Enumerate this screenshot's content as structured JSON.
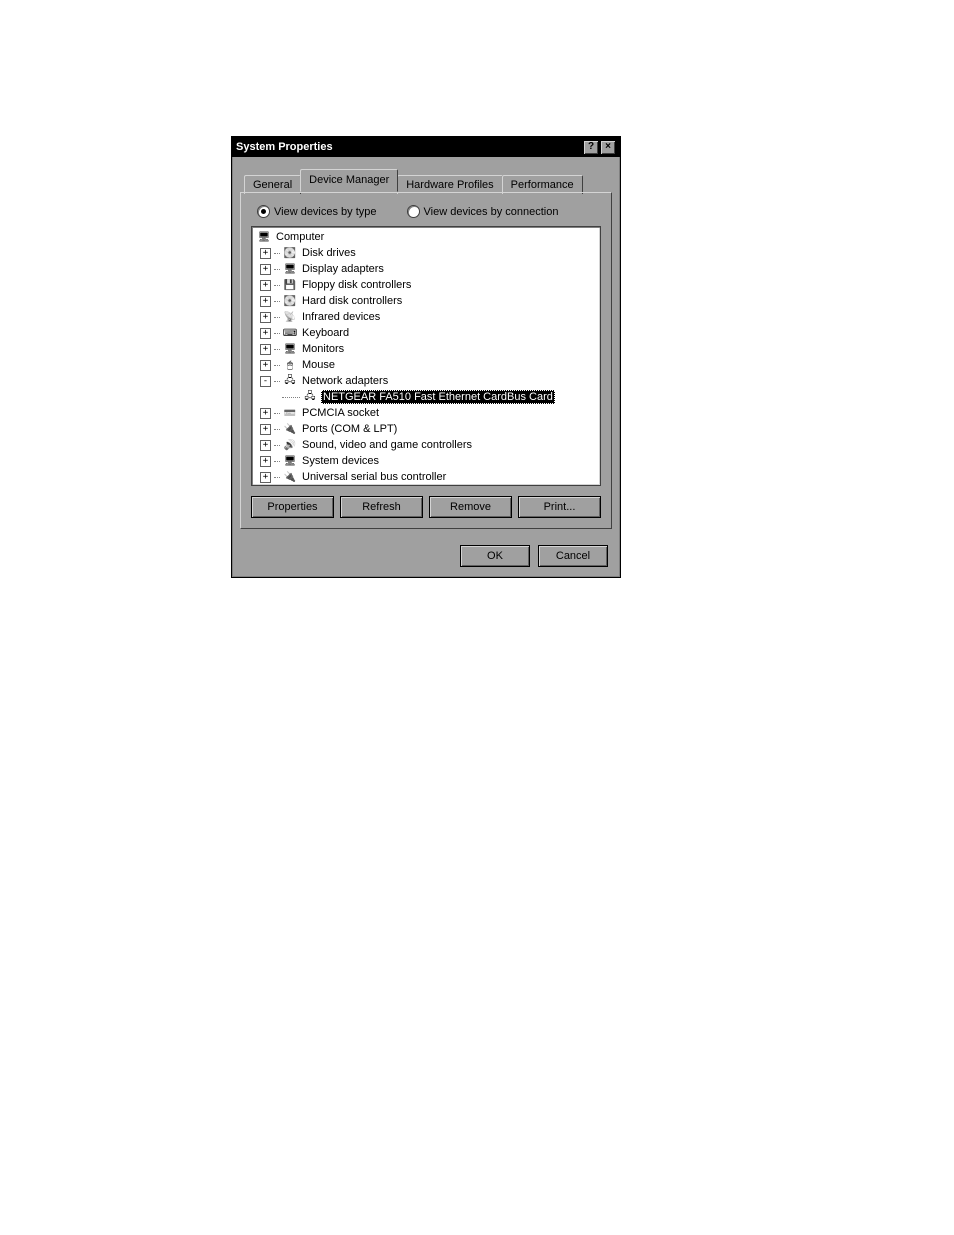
{
  "titlebar": {
    "title": "System Properties",
    "help": "?",
    "close": "×"
  },
  "tabs": {
    "general": "General",
    "device_manager": "Device Manager",
    "hardware_profiles": "Hardware Profiles",
    "performance": "Performance",
    "active": "device_manager"
  },
  "view_options": {
    "by_type": "View devices by type",
    "by_connection": "View devices by connection",
    "selected": "by_type"
  },
  "tree": {
    "root": {
      "label": "Computer",
      "icon": "computer-icon"
    },
    "items": [
      {
        "label": "Disk drives",
        "icon": "disk-icon",
        "expander": "+"
      },
      {
        "label": "Display adapters",
        "icon": "display-icon",
        "expander": "+"
      },
      {
        "label": "Floppy disk controllers",
        "icon": "floppy-icon",
        "expander": "+"
      },
      {
        "label": "Hard disk controllers",
        "icon": "hdd-icon",
        "expander": "+"
      },
      {
        "label": "Infrared devices",
        "icon": "infrared-icon",
        "expander": "+"
      },
      {
        "label": "Keyboard",
        "icon": "keyboard-icon",
        "expander": "+"
      },
      {
        "label": "Monitors",
        "icon": "monitor-icon",
        "expander": "+"
      },
      {
        "label": "Mouse",
        "icon": "mouse-icon",
        "expander": "+"
      },
      {
        "label": "Network adapters",
        "icon": "network-icon",
        "expander": "-",
        "children": [
          {
            "label": "NETGEAR FA510 Fast Ethernet CardBus Card",
            "icon": "netcard-icon",
            "selected": true
          }
        ]
      },
      {
        "label": "PCMCIA socket",
        "icon": "pcmcia-icon",
        "expander": "+"
      },
      {
        "label": "Ports (COM & LPT)",
        "icon": "ports-icon",
        "expander": "+"
      },
      {
        "label": "Sound, video and game controllers",
        "icon": "sound-icon",
        "expander": "+"
      },
      {
        "label": "System devices",
        "icon": "system-icon",
        "expander": "+"
      },
      {
        "label": "Universal serial bus controller",
        "icon": "usb-icon",
        "expander": "+"
      }
    ]
  },
  "panel_buttons": {
    "properties": "Properties",
    "refresh": "Refresh",
    "remove": "Remove",
    "print": "Print..."
  },
  "dialog_buttons": {
    "ok": "OK",
    "cancel": "Cancel"
  }
}
